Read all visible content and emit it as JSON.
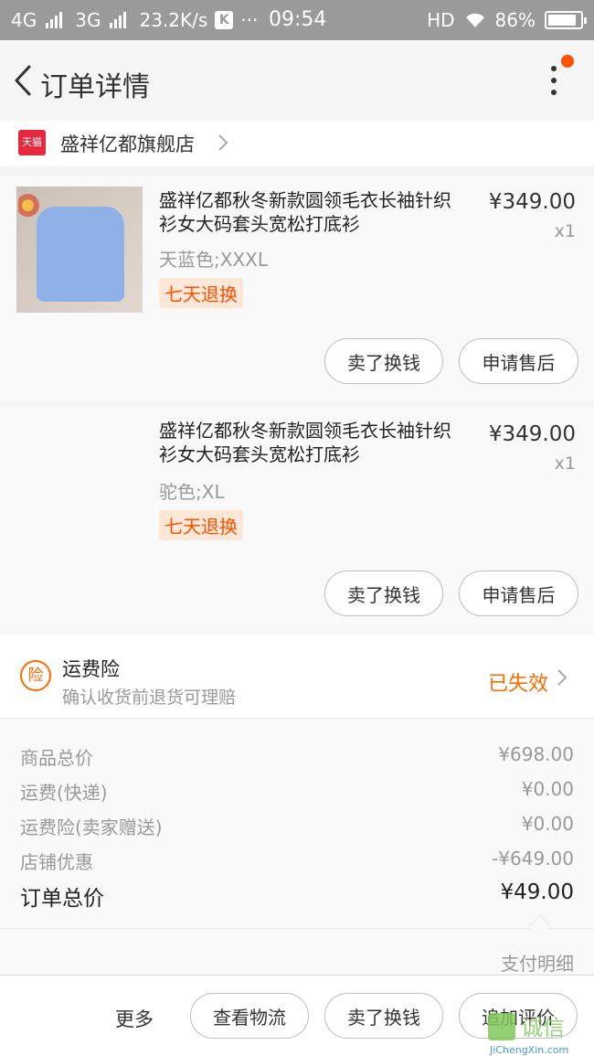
{
  "status_bar": {
    "net1": "4G",
    "net2": "3G",
    "speed": "23.2K/s",
    "app_icon": "K",
    "dots": "···",
    "time": "09:54",
    "hd": "HD",
    "battery": "86%"
  },
  "header": {
    "title": "订单详情"
  },
  "shop": {
    "badge": "天猫",
    "name": "盛祥亿都旗舰店"
  },
  "items": [
    {
      "name": "盛祥亿都秋冬新款圆领毛衣长袖针织衫女大码套头宽松打底衫",
      "price": "¥349.00",
      "qty": "x1",
      "sku": "天蓝色;XXXL",
      "badge": "七天退换",
      "btn_sell": "卖了换钱",
      "btn_after": "申请售后"
    },
    {
      "name": "盛祥亿都秋冬新款圆领毛衣长袖针织衫女大码套头宽松打底衫",
      "price": "¥349.00",
      "qty": "x1",
      "sku": "驼色;XL",
      "badge": "七天退换",
      "btn_sell": "卖了换钱",
      "btn_after": "申请售后"
    }
  ],
  "insurance": {
    "icon_text": "险",
    "title": "运费险",
    "desc": "确认收货前退货可理赔",
    "status": "已失效"
  },
  "summary": {
    "rows": [
      {
        "label": "商品总价",
        "value": "¥698.00"
      },
      {
        "label": "运费(快递)",
        "value": "¥0.00"
      },
      {
        "label": "运费险(卖家赠送)",
        "value": "¥0.00"
      },
      {
        "label": "店铺优惠",
        "value": "-¥649.00"
      }
    ],
    "total_label": "订单总价",
    "total_value": "¥49.00",
    "pay_detail": "支付明细"
  },
  "bottom": {
    "more": "更多",
    "btn_logistics": "查看物流",
    "btn_sell": "卖了换钱",
    "btn_review": "追加评价"
  },
  "watermark": {
    "text": "诚信",
    "sub": "JiChengXin.com"
  },
  "colors": {
    "accent": "#ff5000",
    "tmall": "#e6283c"
  }
}
